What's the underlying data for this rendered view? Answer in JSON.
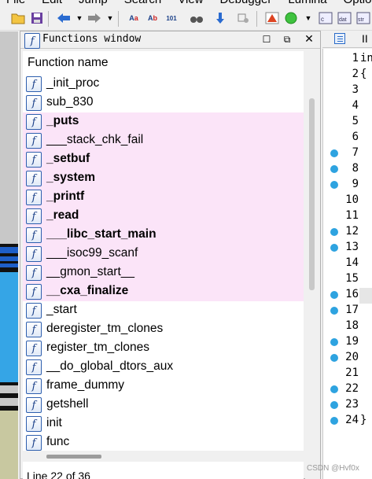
{
  "menubar": [
    "File",
    "Edit",
    "Jump",
    "Search",
    "View",
    "Debugger",
    "Lumina",
    "Options"
  ],
  "functions_window": {
    "title": "Functions window",
    "column_header": "Function name",
    "icon_glyph": "f",
    "status": "Line 22 of 36",
    "items": [
      {
        "name": "_init_proc",
        "highlight": false,
        "bold": false
      },
      {
        "name": "sub_830",
        "highlight": false,
        "bold": false
      },
      {
        "name": "_puts",
        "highlight": true,
        "bold": true
      },
      {
        "name": "___stack_chk_fail",
        "highlight": true,
        "bold": false
      },
      {
        "name": "_setbuf",
        "highlight": true,
        "bold": true
      },
      {
        "name": "_system",
        "highlight": true,
        "bold": true
      },
      {
        "name": "_printf",
        "highlight": true,
        "bold": true
      },
      {
        "name": "_read",
        "highlight": true,
        "bold": true
      },
      {
        "name": "___libc_start_main",
        "highlight": true,
        "bold": true
      },
      {
        "name": "___isoc99_scanf",
        "highlight": true,
        "bold": false
      },
      {
        "name": "__gmon_start__",
        "highlight": true,
        "bold": false
      },
      {
        "name": "__cxa_finalize",
        "highlight": true,
        "bold": true
      },
      {
        "name": "_start",
        "highlight": false,
        "bold": false
      },
      {
        "name": "deregister_tm_clones",
        "highlight": false,
        "bold": false
      },
      {
        "name": "register_tm_clones",
        "highlight": false,
        "bold": false
      },
      {
        "name": "__do_global_dtors_aux",
        "highlight": false,
        "bold": false
      },
      {
        "name": "frame_dummy",
        "highlight": false,
        "bold": false
      },
      {
        "name": "getshell",
        "highlight": false,
        "bold": false
      },
      {
        "name": "init",
        "highlight": false,
        "bold": false
      },
      {
        "name": "func",
        "highlight": false,
        "bold": false
      }
    ]
  },
  "pseudocode": {
    "tab_label": "II",
    "lines": [
      "1",
      "2",
      "3",
      "4",
      "5",
      "6",
      "7",
      "8",
      "9",
      "10",
      "11",
      "12",
      "13",
      "14",
      "15",
      "16",
      "17",
      "18",
      "19",
      "20",
      "21",
      "22",
      "23",
      "24"
    ],
    "breakpoint_lines": [
      "7",
      "8",
      "9",
      "12",
      "13",
      "16",
      "17",
      "19",
      "20",
      "22",
      "23",
      "24"
    ],
    "code": {
      "1": "in",
      "2": "{",
      "24": "}"
    }
  },
  "watermark": "CSDN @Hvf0x",
  "colors": {
    "highlight_row": "#fbe4f8",
    "breakpoint": "#2ea3e0",
    "icon_border": "#2e5fae"
  }
}
